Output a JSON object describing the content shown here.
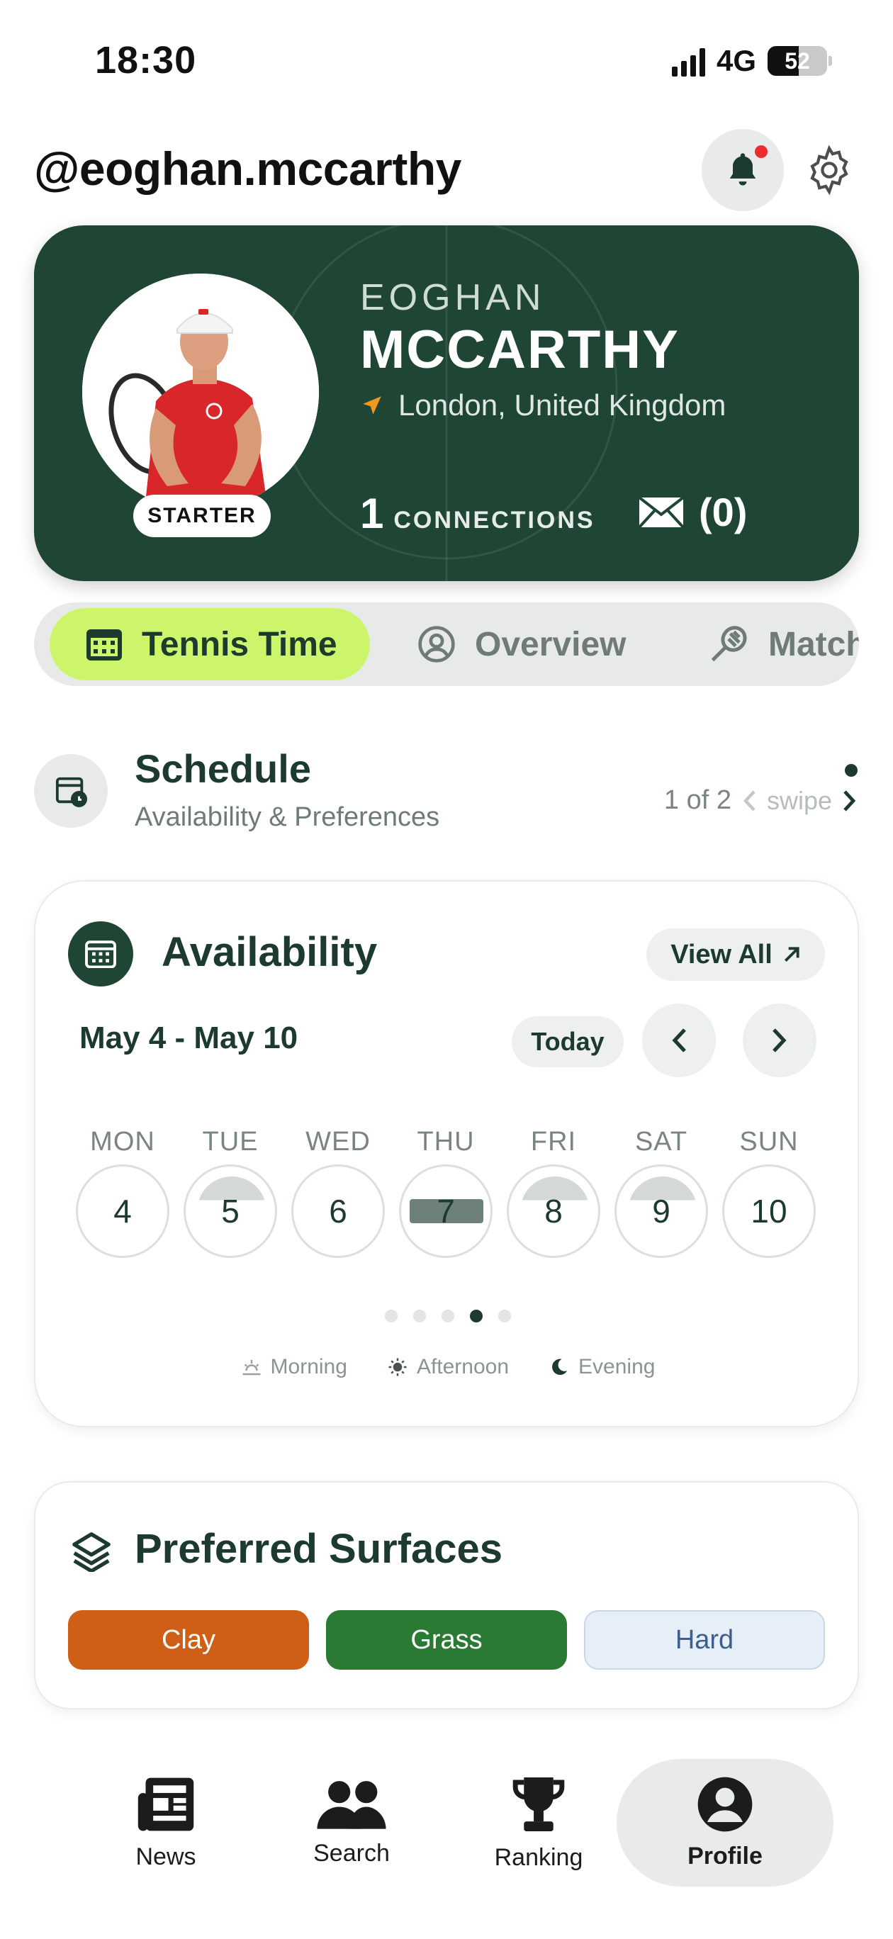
{
  "status_bar": {
    "time": "18:30",
    "network": "4G",
    "battery": "52"
  },
  "header": {
    "username": "@eoghan.mccarthy"
  },
  "profile": {
    "first_name": "EOGHAN",
    "last_name": "MCCARTHY",
    "location": "London, United Kingdom",
    "badge": "STARTER",
    "connections_count": "1",
    "connections_label": "CONNECTIONS",
    "messages_count": "(0)"
  },
  "tabs": [
    {
      "label": "Tennis Time",
      "icon": "calendar-icon",
      "active": true
    },
    {
      "label": "Overview",
      "icon": "user-circle-icon",
      "active": false
    },
    {
      "label": "Matches",
      "icon": "racket-icon",
      "active": false
    }
  ],
  "schedule": {
    "title": "Schedule",
    "subtitle": "Availability & Preferences",
    "pager": "1 of 2",
    "swipe": "swipe"
  },
  "availability": {
    "title": "Availability",
    "view_all": "View All",
    "range": "May 4 - May 10",
    "today": "Today",
    "days": [
      {
        "name": "MON",
        "date": "4",
        "slot": "none"
      },
      {
        "name": "TUE",
        "date": "5",
        "slot": "morning"
      },
      {
        "name": "WED",
        "date": "6",
        "slot": "none"
      },
      {
        "name": "THU",
        "date": "7",
        "slot": "afternoon"
      },
      {
        "name": "FRI",
        "date": "8",
        "slot": "morning"
      },
      {
        "name": "SAT",
        "date": "9",
        "slot": "morning"
      },
      {
        "name": "SUN",
        "date": "10",
        "slot": "none"
      }
    ],
    "page_dots": 5,
    "active_dot": 3,
    "legend": [
      "Morning",
      "Afternoon",
      "Evening"
    ]
  },
  "surfaces": {
    "title": "Preferred Surfaces",
    "items": [
      "Clay",
      "Grass",
      "Hard"
    ]
  },
  "bottom_nav": [
    {
      "label": "News",
      "icon": "news-icon"
    },
    {
      "label": "Search",
      "icon": "people-icon"
    },
    {
      "label": "Ranking",
      "icon": "trophy-icon"
    },
    {
      "label": "Profile",
      "icon": "profile-icon",
      "active": true
    }
  ],
  "colors": {
    "brand_green": "#1f4534",
    "accent_lime": "#cdf56b",
    "clay": "#cf5f17",
    "grass": "#2b7a33",
    "hard": "#e6eef7",
    "notification": "#ec2d2d"
  }
}
